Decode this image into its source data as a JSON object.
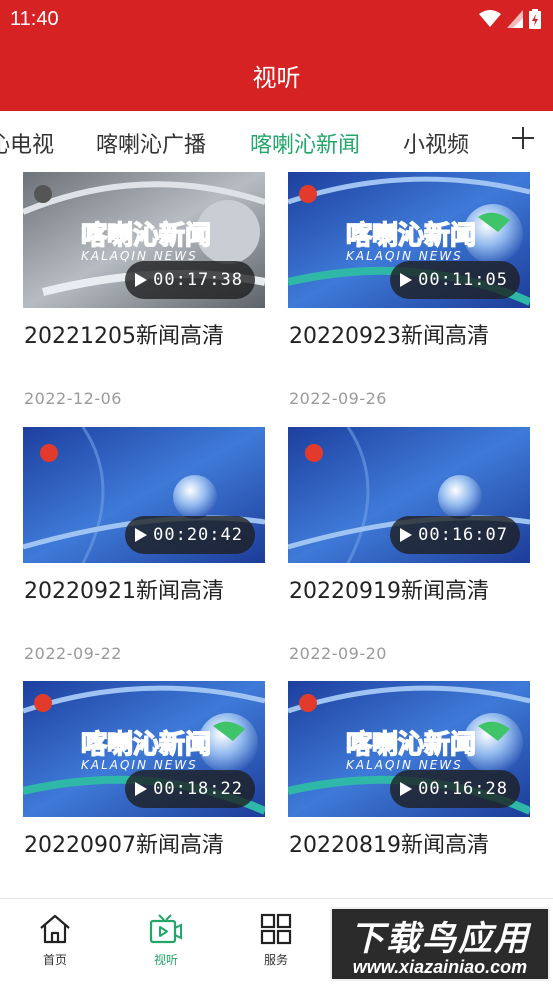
{
  "status_bar": {
    "time": "11:40",
    "icons": [
      "wifi-icon",
      "signal-icon",
      "battery-icon"
    ]
  },
  "header": {
    "title": "视听"
  },
  "tabs": [
    {
      "label": "沁电视",
      "active": false
    },
    {
      "label": "喀喇沁广播",
      "active": false
    },
    {
      "label": "喀喇沁新闻",
      "active": true
    },
    {
      "label": "小视频",
      "active": false
    }
  ],
  "add_tab_icon": "plus-icon",
  "thumbnail_text": {
    "main": "喀喇沁新闻",
    "sub": "KALAQIN NEWS"
  },
  "videos": [
    {
      "title": "20221205新闻高清",
      "duration": "00:17:38",
      "date": "2022-12-06"
    },
    {
      "title": "20220923新闻高清",
      "duration": "00:11:05",
      "date": "2022-09-26"
    },
    {
      "title": "20220921新闻高清",
      "duration": "00:20:42",
      "date": "2022-09-22"
    },
    {
      "title": "20220919新闻高清",
      "duration": "00:16:07",
      "date": "2022-09-20"
    },
    {
      "title": "20220907新闻高清",
      "duration": "00:18:22",
      "date": ""
    },
    {
      "title": "20220819新闻高清",
      "duration": "00:16:28",
      "date": ""
    }
  ],
  "bottom_nav": [
    {
      "label": "首页",
      "icon": "home-icon",
      "active": false
    },
    {
      "label": "视听",
      "icon": "tv-icon",
      "active": true
    },
    {
      "label": "服务",
      "icon": "grid-icon",
      "active": false
    }
  ],
  "watermark": {
    "main": "下载鸟应用",
    "url": "www.xiazainiao.com"
  },
  "colors": {
    "brand_red": "#d72223",
    "accent_green": "#22a66a"
  }
}
